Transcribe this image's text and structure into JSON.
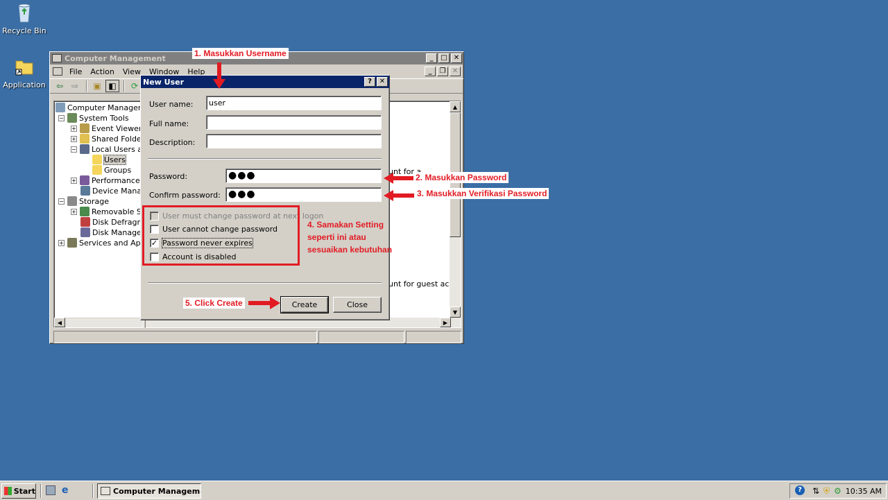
{
  "desktop": {
    "icons": [
      {
        "label": "Recycle Bin",
        "icon": "recycle-bin-icon"
      },
      {
        "label": "Application",
        "icon": "folder-shortcut-icon"
      }
    ]
  },
  "main_window": {
    "title": "Computer Management",
    "menu": [
      "File",
      "Action",
      "View",
      "Window",
      "Help"
    ],
    "tree": [
      {
        "label": "Computer Management"
      },
      {
        "label": "System Tools"
      },
      {
        "label": "Event Viewer"
      },
      {
        "label": "Shared Folders"
      },
      {
        "label": "Local Users and"
      },
      {
        "label": "Users"
      },
      {
        "label": "Groups"
      },
      {
        "label": "Performance Lo"
      },
      {
        "label": "Device Manage"
      },
      {
        "label": "Storage"
      },
      {
        "label": "Removable Sto"
      },
      {
        "label": "Disk Defragmer"
      },
      {
        "label": "Disk Manageme"
      },
      {
        "label": "Services and Applic"
      }
    ],
    "right_pane_text": [
      "unt for a",
      "unt for guest acces"
    ]
  },
  "dialog": {
    "title": "New User",
    "fields": {
      "username_label": "User name:",
      "username_value": "user",
      "fullname_label": "Full name:",
      "fullname_value": "",
      "description_label": "Description:",
      "description_value": "",
      "password_label": "Password:",
      "password_value": "●●●",
      "confirm_label": "Confirm password:",
      "confirm_value": "●●●"
    },
    "checkboxes": [
      {
        "label": "User must change password at next logon",
        "checked": false,
        "disabled": true
      },
      {
        "label": "User cannot change password",
        "checked": false,
        "disabled": false
      },
      {
        "label": "Password never expires",
        "checked": true,
        "disabled": false
      },
      {
        "label": "Account is disabled",
        "checked": false,
        "disabled": false
      }
    ],
    "buttons": {
      "create": "Create",
      "close": "Close"
    }
  },
  "annotations": {
    "step1": "1. Masukkan Username",
    "step2": "2. Masukkan Password",
    "step3": "3. Masukkan Verifikasi Password",
    "step4": "4. Samakan Setting seperti ini atau sesuaikan kebutuhan",
    "step5": "5. Click Create",
    "color": "#e21b23"
  },
  "taskbar": {
    "start_label": "Start",
    "task_label": "Computer Manageme...",
    "clock": "10:35 AM"
  }
}
